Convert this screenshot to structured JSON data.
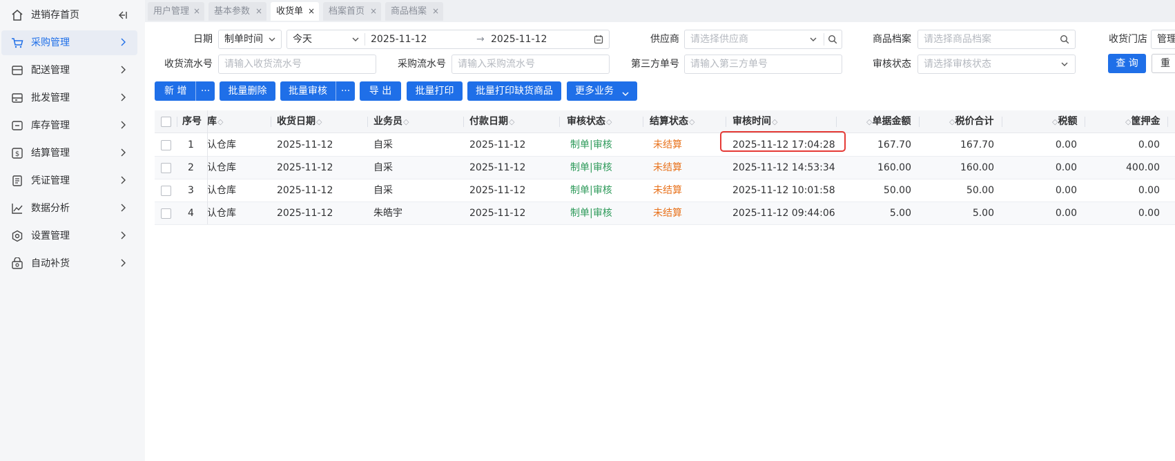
{
  "sidebar": {
    "items": [
      {
        "label": "进销存首页",
        "icon": "home-icon"
      },
      {
        "label": "采购管理",
        "icon": "cart-icon",
        "active": true
      },
      {
        "label": "配送管理",
        "icon": "delivery-icon"
      },
      {
        "label": "批发管理",
        "icon": "wholesale-icon"
      },
      {
        "label": "库存管理",
        "icon": "inventory-icon"
      },
      {
        "label": "结算管理",
        "icon": "dollar-icon"
      },
      {
        "label": "凭证管理",
        "icon": "voucher-icon"
      },
      {
        "label": "数据分析",
        "icon": "chart-line-icon"
      },
      {
        "label": "设置管理",
        "icon": "settings-hex-icon"
      },
      {
        "label": "自动补货",
        "icon": "auto-replenish-icon"
      }
    ],
    "collapse_icon": "collapse-sidebar-icon"
  },
  "tabs": [
    {
      "label": "用户管理",
      "close": "×"
    },
    {
      "label": "基本参数",
      "close": "×"
    },
    {
      "label": "收货单",
      "close": "×",
      "active": true
    },
    {
      "label": "档案首页",
      "close": "×"
    },
    {
      "label": "商品档案",
      "close": "×"
    }
  ],
  "filters": {
    "date_label": "日期",
    "date_type_value": "制单时间",
    "date_range_value": "今天",
    "date_start": "2025-11-12",
    "date_arrow": "→",
    "date_end": "2025-11-12",
    "supplier_label": "供应商",
    "supplier_placeholder": "请选择供应商",
    "product_label": "商品档案",
    "product_placeholder": "请选择商品档案",
    "store_label": "收货门店",
    "store_value": "管理",
    "receipt_no_label": "收货流水号",
    "receipt_no_placeholder": "请输入收货流水号",
    "purchase_no_label": "采购流水号",
    "purchase_no_placeholder": "请输入采购流水号",
    "third_party_label": "第三方单号",
    "third_party_placeholder": "请输入第三方单号",
    "audit_label": "审核状态",
    "audit_placeholder": "请选择审核状态",
    "query_button": "查 询",
    "reset_button": "重 置"
  },
  "toolbar": {
    "add": "新 增",
    "more_dots": "···",
    "batch_delete": "批量删除",
    "batch_audit": "批量审核",
    "export": "导 出",
    "batch_print": "批量打印",
    "batch_print_short": "批量打印缺货商品",
    "more_business": "更多业务"
  },
  "table": {
    "headers": {
      "seq": "序号",
      "warehouse": "库",
      "receive_date": "收货日期",
      "salesman": "业务员",
      "pay_date": "付款日期",
      "audit_status": "审核状态",
      "settle_status": "结算状态",
      "audit_time": "审核时间",
      "amount": "单据金额",
      "tax_total": "税价合计",
      "tax": "税额",
      "deposit": "筐押金"
    },
    "sort_glyph": "◇",
    "rows": [
      {
        "seq": "1",
        "warehouse": "认仓库",
        "receive_date": "2025-11-12",
        "salesman": "自采",
        "pay_date": "2025-11-12",
        "audit_status": "制单|审核",
        "settle_status": "未结算",
        "audit_time": "2025-11-12 17:04:28",
        "amount": "167.70",
        "tax_total": "167.70",
        "tax": "0.00",
        "deposit": "0.00"
      },
      {
        "seq": "2",
        "warehouse": "认仓库",
        "receive_date": "2025-11-12",
        "salesman": "自采",
        "pay_date": "2025-11-12",
        "audit_status": "制单|审核",
        "settle_status": "未结算",
        "audit_time": "2025-11-12 14:53:34",
        "amount": "160.00",
        "tax_total": "160.00",
        "tax": "0.00",
        "deposit": "400.00"
      },
      {
        "seq": "3",
        "warehouse": "认仓库",
        "receive_date": "2025-11-12",
        "salesman": "自采",
        "pay_date": "2025-11-12",
        "audit_status": "制单|审核",
        "settle_status": "未结算",
        "audit_time": "2025-11-12 10:01:58",
        "amount": "50.00",
        "tax_total": "50.00",
        "tax": "0.00",
        "deposit": "0.00"
      },
      {
        "seq": "4",
        "warehouse": "认仓库",
        "receive_date": "2025-11-12",
        "salesman": "朱皓宇",
        "pay_date": "2025-11-12",
        "audit_status": "制单|审核",
        "settle_status": "未结算",
        "audit_time": "2025-11-12 09:44:06",
        "amount": "5.00",
        "tax_total": "5.00",
        "tax": "0.00",
        "deposit": "0.00"
      }
    ]
  },
  "colors": {
    "primary": "#1f6fe8",
    "status_green": "#2e9a5a",
    "status_orange": "#e8721c",
    "highlight": "#e53935"
  }
}
